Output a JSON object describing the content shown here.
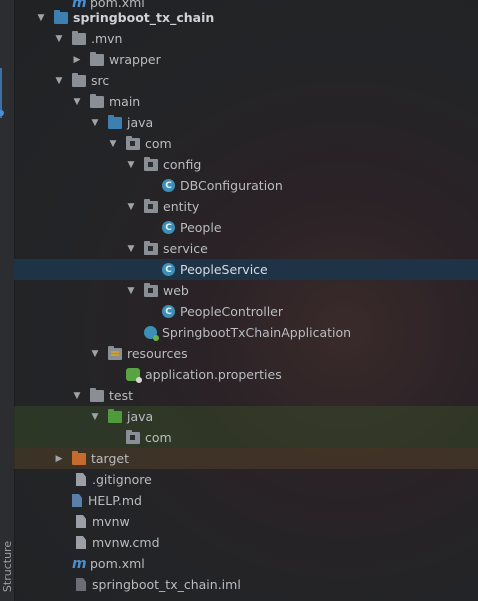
{
  "sidebar": {
    "structure_label": "Structure"
  },
  "tree": {
    "top_partial": "pom.xml",
    "items": [
      {
        "label": "springboot_tx_chain"
      },
      {
        "label": ".mvn"
      },
      {
        "label": "wrapper"
      },
      {
        "label": "src"
      },
      {
        "label": "main"
      },
      {
        "label": "java"
      },
      {
        "label": "com"
      },
      {
        "label": "config"
      },
      {
        "label": "DBConfiguration"
      },
      {
        "label": "entity"
      },
      {
        "label": "People"
      },
      {
        "label": "service"
      },
      {
        "label": "PeopleService"
      },
      {
        "label": "web"
      },
      {
        "label": "PeopleController"
      },
      {
        "label": "SpringbootTxChainApplication"
      },
      {
        "label": "resources"
      },
      {
        "label": "application.properties"
      },
      {
        "label": "test"
      },
      {
        "label": "java"
      },
      {
        "label": "com"
      },
      {
        "label": "target"
      },
      {
        "label": ".gitignore"
      },
      {
        "label": "HELP.md"
      },
      {
        "label": "mvnw"
      },
      {
        "label": "mvnw.cmd"
      },
      {
        "label": "pom.xml"
      },
      {
        "label": "springboot_tx_chain.iml"
      }
    ]
  },
  "colors": {
    "selection": "#1f3347",
    "folder_blue": "#3d7fb0",
    "folder_green": "#4f9a3a",
    "folder_orange": "#c76a2d",
    "class_icon": "#3c8fb6"
  }
}
